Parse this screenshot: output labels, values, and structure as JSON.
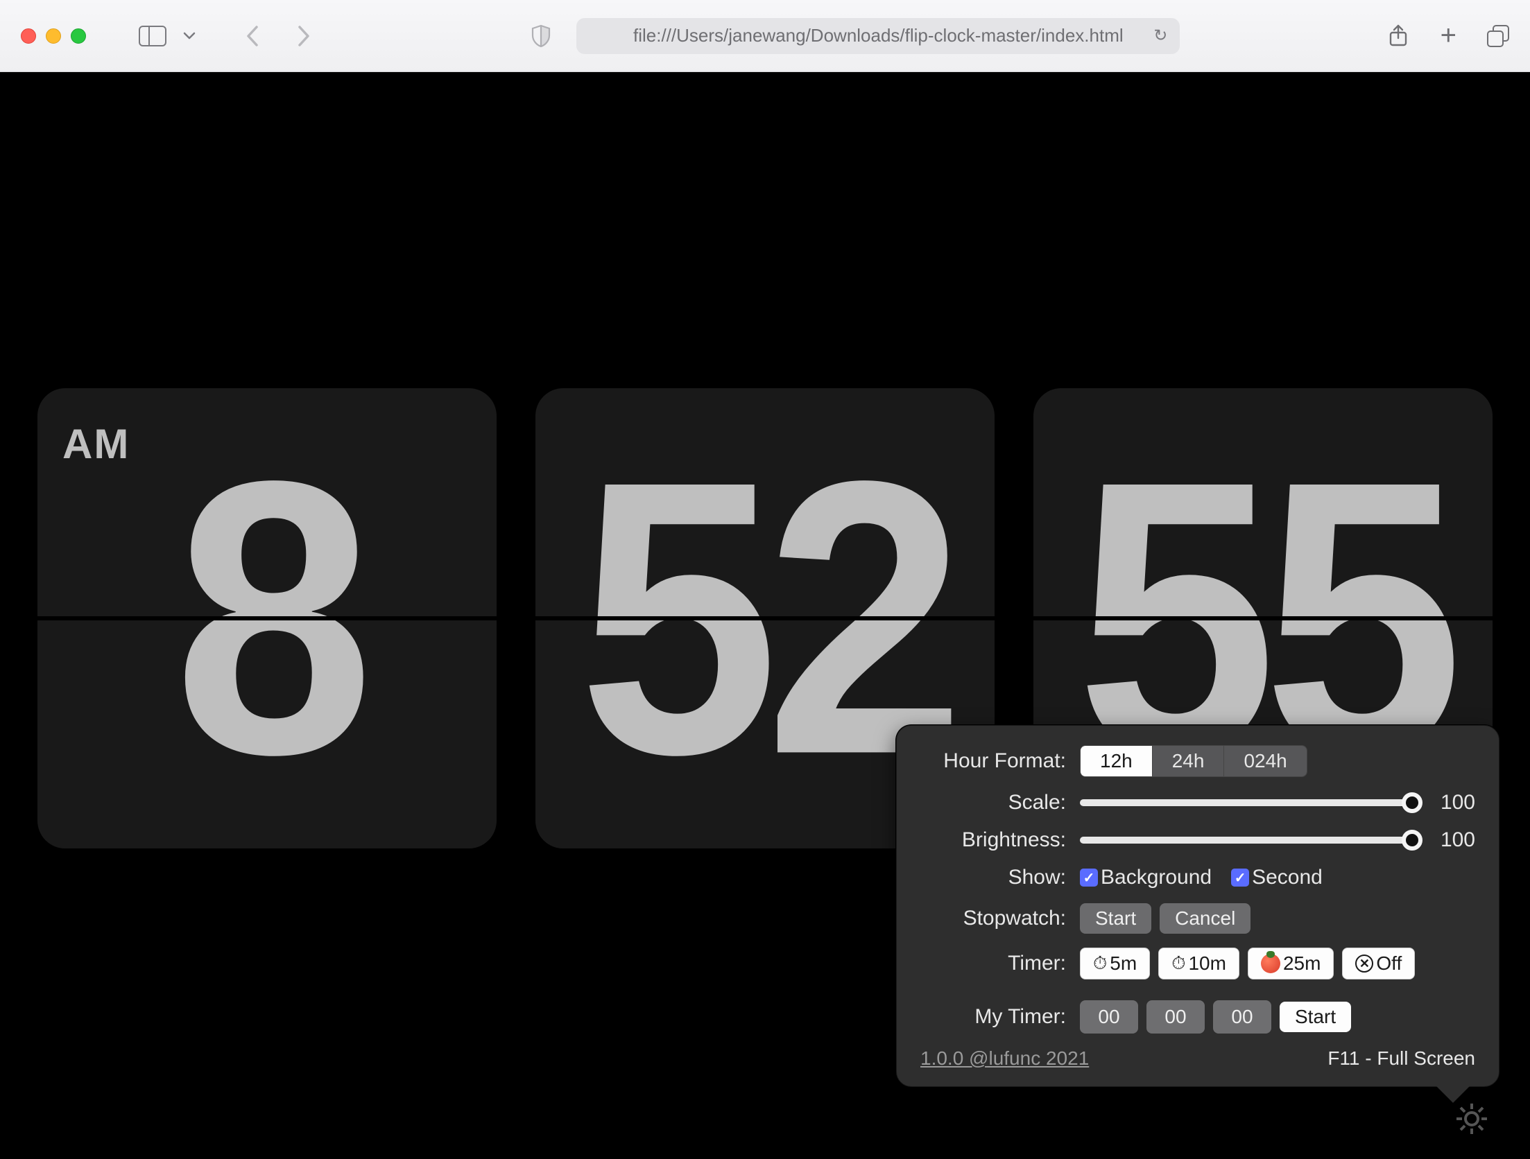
{
  "browser": {
    "url": "file:///Users/janewang/Downloads/flip-clock-master/index.html"
  },
  "clock": {
    "ampm": "AM",
    "hour": "8",
    "minute": "52",
    "second": "55"
  },
  "settings": {
    "labels": {
      "hour_format": "Hour Format:",
      "scale": "Scale:",
      "brightness": "Brightness:",
      "show": "Show:",
      "stopwatch": "Stopwatch:",
      "timer": "Timer:",
      "my_timer": "My Timer:"
    },
    "hour_format": {
      "options": [
        "12h",
        "24h",
        "024h"
      ],
      "selected": "12h"
    },
    "scale": 100,
    "brightness": 100,
    "show": {
      "background": {
        "label": "Background",
        "checked": true
      },
      "second": {
        "label": "Second",
        "checked": true
      }
    },
    "stopwatch": {
      "start": "Start",
      "cancel": "Cancel"
    },
    "timer": {
      "t5": "5m",
      "t10": "10m",
      "t25": "25m",
      "off": "Off"
    },
    "my_timer": {
      "hh": "00",
      "mm": "00",
      "ss": "00",
      "start": "Start"
    },
    "footer": {
      "version_link": "1.0.0 @lufunc 2021",
      "fullscreen_hint": "F11 - Full Screen"
    }
  }
}
